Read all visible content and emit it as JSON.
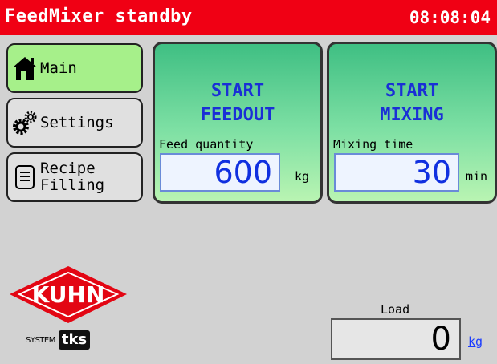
{
  "header": {
    "title": "FeedMixer standby",
    "clock": "08:08:04",
    "bg_color": "#f00014"
  },
  "nav": {
    "items": [
      {
        "label": "Main",
        "icon": "house-icon",
        "active": true
      },
      {
        "label": "Settings",
        "icon": "gears-icon",
        "active": false
      },
      {
        "label_line1": "Recipe",
        "label_line2": "Filling",
        "icon": "document-icon",
        "active": false
      }
    ]
  },
  "actions": {
    "feedout": {
      "line1": "START",
      "line2": "FEEDOUT",
      "field_label": "Feed quantity",
      "value": "600",
      "unit": "kg"
    },
    "mixing": {
      "line1": "START",
      "line2": "MIXING",
      "field_label": "Mixing time",
      "value": "30",
      "unit": "min"
    }
  },
  "logo": {
    "brand": "KUHN",
    "system": "SYSTEM",
    "tks": "tks"
  },
  "load": {
    "label": "Load",
    "value": "0",
    "unit": "kg"
  }
}
